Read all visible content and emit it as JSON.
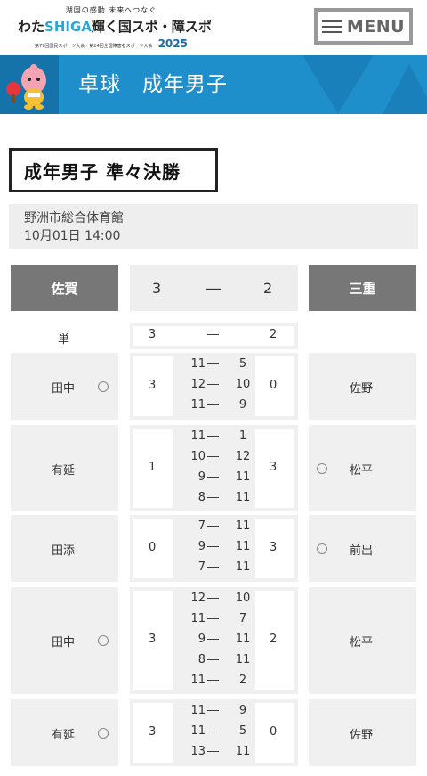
{
  "header": {
    "logo_tagline": "湖国の感動 未来へつなぐ",
    "logo_main_a": "わた",
    "logo_main_b": "SHIGA",
    "logo_main_c": "輝く国スポ・障スポ",
    "logo_sub": "第79回国民スポーツ大会・第24回全国障害者スポーツ大会",
    "logo_year": "2025",
    "menu_label": "MENU"
  },
  "banner": {
    "title": "卓球　成年男子"
  },
  "page_title": "成年男子 準々決勝",
  "venue": {
    "name": "野洲市総合体育館",
    "datetime": "10月01日 14:00"
  },
  "match": {
    "team_left": "佐賀",
    "team_right": "三重",
    "score_left": "3",
    "score_right": "2",
    "dash": "―",
    "type_label": "単",
    "type_score_left": "3",
    "type_score_right": "2",
    "win_mark": "◯",
    "games": [
      {
        "left_player": "田中",
        "right_player": "佐野",
        "left_won": true,
        "right_won": false,
        "left_total": "3",
        "right_total": "0",
        "sets": [
          [
            "11",
            "5"
          ],
          [
            "12",
            "10"
          ],
          [
            "11",
            "9"
          ]
        ]
      },
      {
        "left_player": "有延",
        "right_player": "松平",
        "left_won": false,
        "right_won": true,
        "left_total": "1",
        "right_total": "3",
        "sets": [
          [
            "11",
            "1"
          ],
          [
            "10",
            "12"
          ],
          [
            "9",
            "11"
          ],
          [
            "8",
            "11"
          ]
        ]
      },
      {
        "left_player": "田添",
        "right_player": "前出",
        "left_won": false,
        "right_won": true,
        "left_total": "0",
        "right_total": "3",
        "sets": [
          [
            "7",
            "11"
          ],
          [
            "9",
            "11"
          ],
          [
            "7",
            "11"
          ]
        ]
      },
      {
        "left_player": "田中",
        "right_player": "松平",
        "left_won": true,
        "right_won": false,
        "left_total": "3",
        "right_total": "2",
        "sets": [
          [
            "12",
            "10"
          ],
          [
            "11",
            "7"
          ],
          [
            "9",
            "11"
          ],
          [
            "8",
            "11"
          ],
          [
            "11",
            "2"
          ]
        ]
      },
      {
        "left_player": "有延",
        "right_player": "佐野",
        "left_won": true,
        "right_won": false,
        "left_total": "3",
        "right_total": "0",
        "sets": [
          [
            "11",
            "9"
          ],
          [
            "11",
            "5"
          ],
          [
            "13",
            "11"
          ]
        ]
      }
    ]
  },
  "colors": {
    "banner_blue": "#1f8fcc",
    "team_gray": "#777777",
    "cell_gray": "#f0f0f0"
  }
}
